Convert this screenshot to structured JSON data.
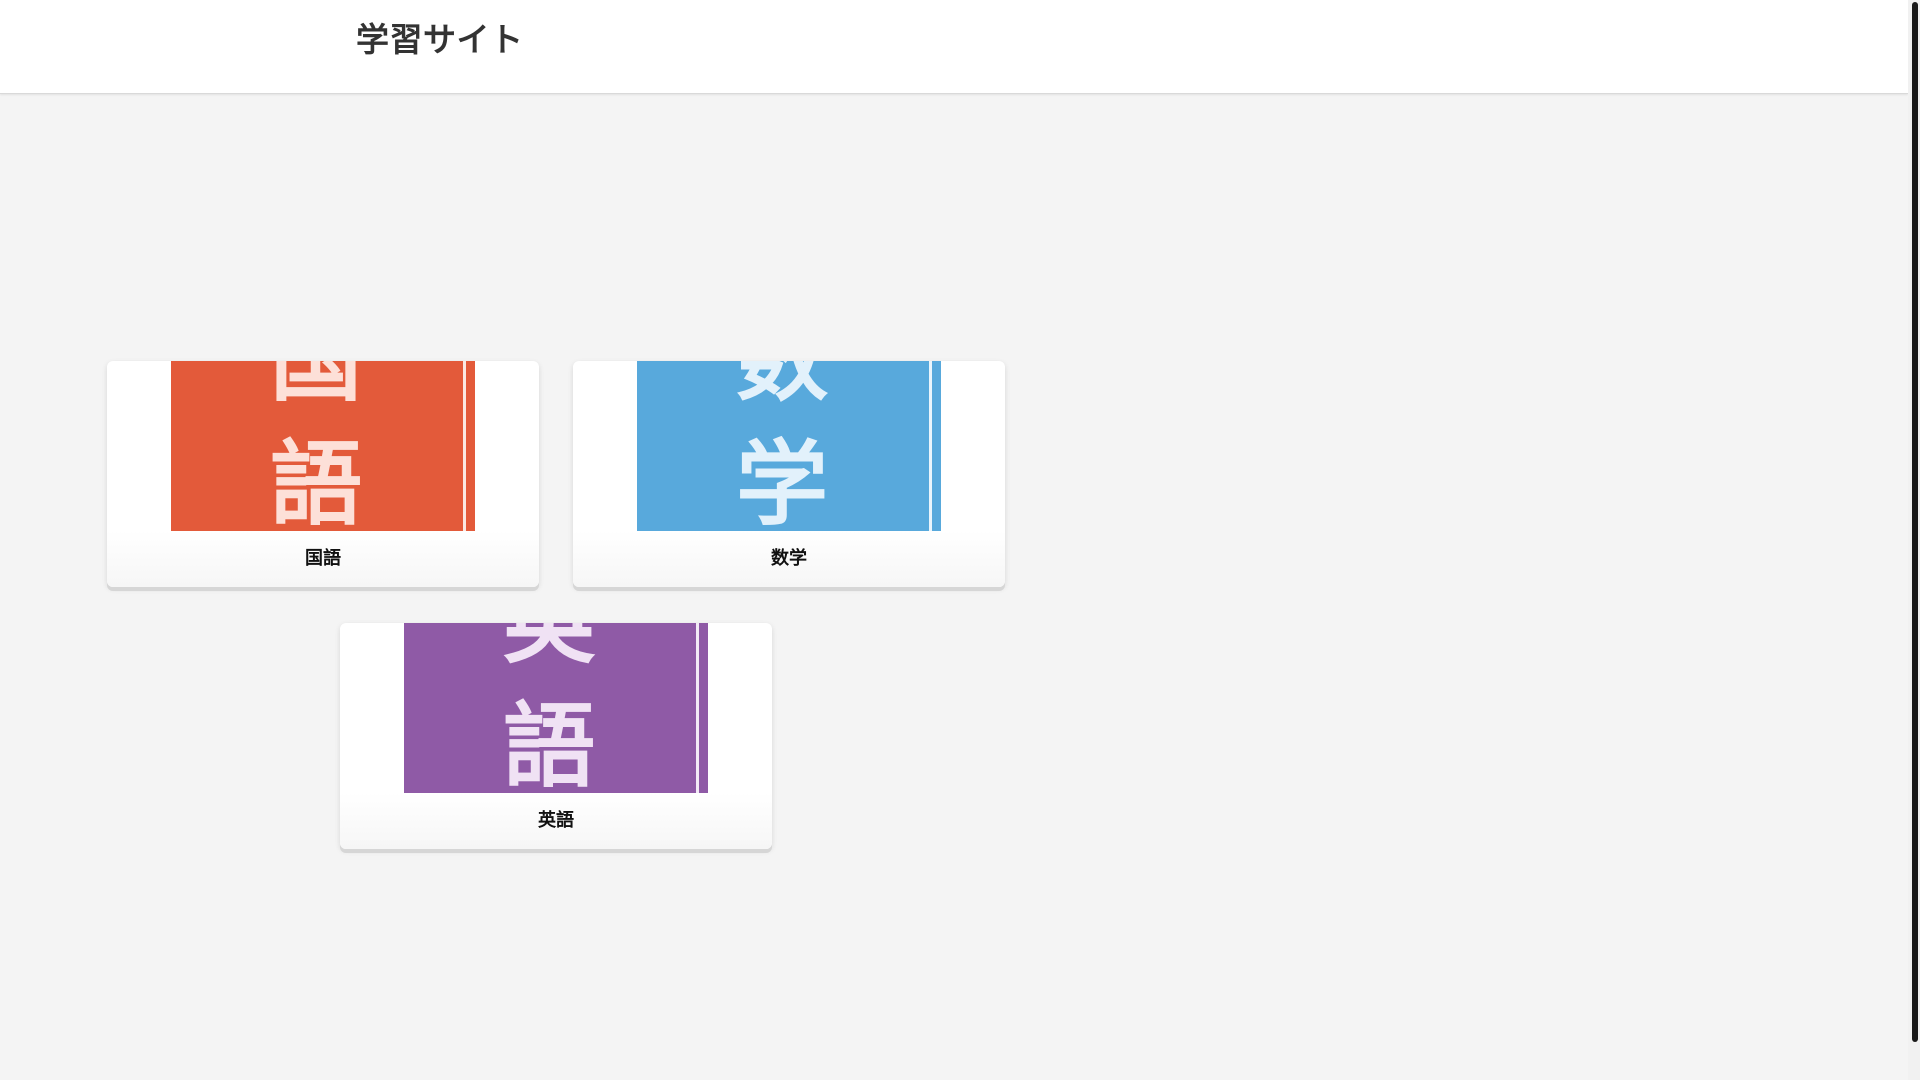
{
  "header": {
    "title": "学習サイト"
  },
  "subjects": [
    {
      "label": "国語",
      "image_glyphs": [
        "国",
        "語"
      ],
      "color": "#e35a3a",
      "glyph_color": "#fde0d8",
      "stripe_color": "#fbe8e2"
    },
    {
      "label": "数学",
      "image_glyphs": [
        "数",
        "学"
      ],
      "color": "#58a9dc",
      "glyph_color": "#e2f1fb",
      "stripe_color": "#eaf5fc"
    },
    {
      "label": "英語",
      "image_glyphs": [
        "英",
        "語"
      ],
      "color": "#8f5aa6",
      "glyph_color": "#f0e2f4",
      "stripe_color": "#f3eaf6"
    }
  ]
}
